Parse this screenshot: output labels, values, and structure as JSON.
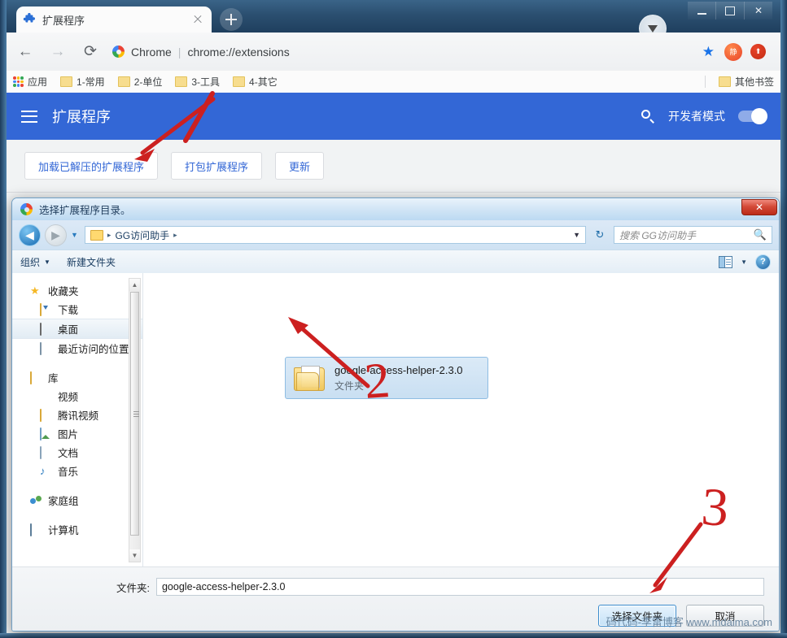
{
  "browser": {
    "tab": {
      "title": "扩展程序",
      "favicon": "puzzle-piece-icon",
      "close": "×"
    },
    "newtab_label": "+",
    "caption": {
      "minimize": "—",
      "maximize": "□",
      "close": "✕"
    },
    "toolbar": {
      "back": "←",
      "forward": "→",
      "reload": "⟳",
      "origin": "Chrome",
      "separator": "|",
      "url": "chrome://extensions",
      "bookmark_star": "★",
      "extensions": [
        "静",
        "⬆"
      ]
    },
    "bookmarks": {
      "apps_label": "应用",
      "items": [
        "1-常用",
        "2-单位",
        "3-工具",
        "4-其它"
      ],
      "other_label": "其他书签"
    }
  },
  "extensions_page": {
    "header_title": "扩展程序",
    "search_icon": "search-icon",
    "devmode_label": "开发者模式",
    "devmode_on": true,
    "actions": [
      "加载已解压的扩展程序",
      "打包扩展程序",
      "更新"
    ]
  },
  "file_dialog": {
    "title": "选择扩展程序目录。",
    "close_label": "✕",
    "nav": {
      "back": "◀",
      "forward": "▶",
      "history_caret": "▼",
      "breadcrumb": [
        "GG访问助手"
      ],
      "breadcrumb_sep": "▸",
      "dropdown_caret": "▼",
      "refresh": "↻",
      "search_placeholder": "搜索 GG访问助手",
      "search_icon": "magnifier-icon"
    },
    "toolbar": {
      "organize": "组织",
      "organize_caret": "▼",
      "new_folder": "新建文件夹",
      "view_caret": "▼",
      "help": "?"
    },
    "sidebar": [
      {
        "label": "收藏夹",
        "icon": "star-icon",
        "indent": false,
        "selected": false
      },
      {
        "label": "下载",
        "icon": "download-folder-icon",
        "indent": true,
        "selected": false
      },
      {
        "label": "桌面",
        "icon": "desktop-icon",
        "indent": true,
        "selected": true
      },
      {
        "label": "最近访问的位置",
        "icon": "recent-places-icon",
        "indent": true,
        "selected": false
      },
      {
        "label": "库",
        "icon": "library-icon",
        "indent": false,
        "selected": false
      },
      {
        "label": "视频",
        "icon": "video-icon",
        "indent": true,
        "selected": false
      },
      {
        "label": "腾讯视频",
        "icon": "folder-icon",
        "indent": true,
        "selected": false
      },
      {
        "label": "图片",
        "icon": "pictures-icon",
        "indent": true,
        "selected": false
      },
      {
        "label": "文档",
        "icon": "documents-icon",
        "indent": true,
        "selected": false
      },
      {
        "label": "音乐",
        "icon": "music-icon",
        "indent": true,
        "selected": false
      },
      {
        "label": "家庭组",
        "icon": "homegroup-icon",
        "indent": false,
        "selected": false
      },
      {
        "label": "计算机",
        "icon": "computer-icon",
        "indent": false,
        "selected": false
      }
    ],
    "files": [
      {
        "name": "google-access-helper-2.3.0",
        "type": "文件夹",
        "selected": true
      }
    ],
    "footer": {
      "folder_label": "文件夹:",
      "folder_value": "google-access-helper-2.3.0",
      "select_button": "选择文件夹",
      "cancel_button": "取消"
    }
  },
  "annotations": {
    "step2": "2",
    "step3": "3",
    "color": "#cc2020"
  },
  "watermark": "码代码-李雷博客 www.mdaima.com"
}
